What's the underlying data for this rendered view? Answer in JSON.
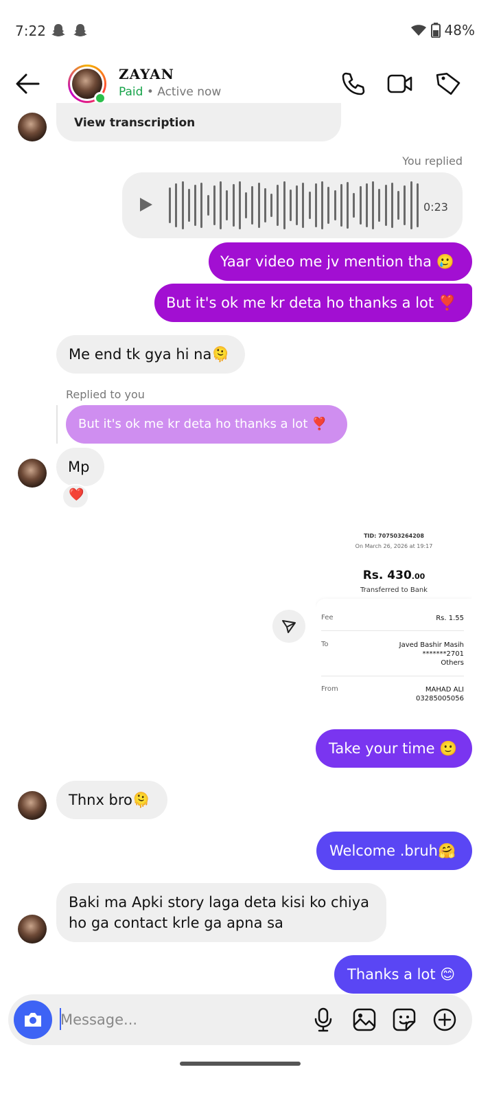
{
  "status_bar": {
    "time": "7:22",
    "battery": "48%"
  },
  "header": {
    "contact_name": "ZAYAN",
    "paid_label": "Paid",
    "active_status": " • Active now"
  },
  "messages": {
    "transcription_link": "View transcription",
    "you_replied_label": "You replied",
    "voice_duration": "0:23",
    "out_1": "Yaar video me jv mention tha 🥲",
    "out_2": "But it's ok me kr deta ho thanks a lot ❣️",
    "in_1": "Me end tk gya hi na🫠",
    "replied_to_you_label": "Replied to you",
    "quoted_reply": "But it's ok me kr deta ho thanks a lot ❣️",
    "in_2": "Mp",
    "reaction": "❤️",
    "out_3": "Take your time 🙂",
    "in_3": "Thnx bro🫠",
    "out_4": "Welcome .bruh🤗",
    "in_4_line1": "Baki ma Apki story laga deta kisi ko chiya",
    "in_4_line2": "ho ga contact krle ga apna sa",
    "out_5": "Thanks a lot 😊"
  },
  "receipt": {
    "tid": "TID: 707503264208",
    "date": "On March 26, 2026 at 19:17",
    "amount_main": "Rs. 430",
    "amount_decimal": ".00",
    "transfer_type": "Transferred to Bank",
    "fee_label": "Fee",
    "fee_value": "Rs. 1.55",
    "to_label": "To",
    "to_name": "Javed Bashir Masih",
    "to_account": "*******2701",
    "to_bank": "Others",
    "from_label": "From",
    "from_name": "MAHAD ALI",
    "from_number": "03285005056"
  },
  "composer": {
    "placeholder": "Message..."
  },
  "colors": {
    "outgoing_purple": "#a20fd2",
    "outgoing_violet": "#7a35f0",
    "outgoing_blue": "#5a46f4",
    "quoted_bubble": "#cf8ef0",
    "incoming_bubble": "#efefef",
    "camera_button": "#3d63f5",
    "paid_green": "#17a34a",
    "online_green": "#2bbf4b"
  },
  "icons": {
    "back": "arrow-left-icon",
    "call": "phone-icon",
    "video": "video-camera-icon",
    "tag": "tag-icon",
    "forward": "send-icon",
    "play": "play-icon",
    "mic": "microphone-icon",
    "gallery": "image-icon",
    "sticker": "sticker-icon",
    "add": "plus-circle-icon",
    "camera": "camera-icon"
  }
}
